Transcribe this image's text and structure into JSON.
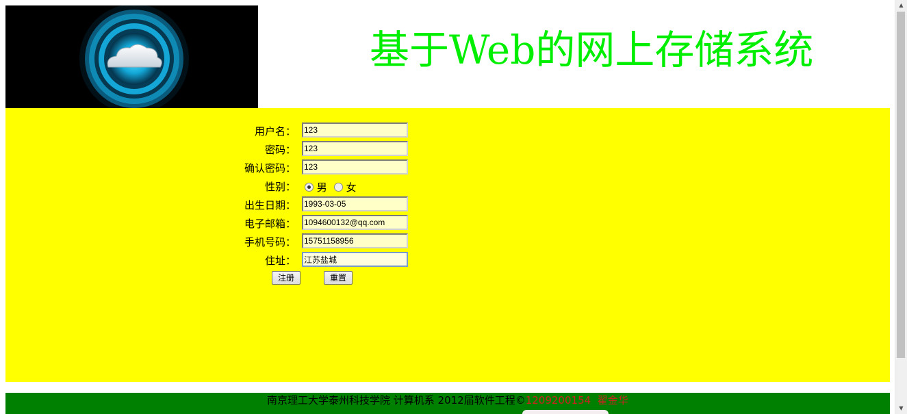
{
  "header": {
    "title": "基于Web的网上存储系统",
    "logo_icon": "cloud-icon"
  },
  "form": {
    "username": {
      "label": "用户名：",
      "value": "123"
    },
    "password": {
      "label": "密码：",
      "value": "123"
    },
    "confirm_password": {
      "label": "确认密码：",
      "value": "123"
    },
    "gender": {
      "label": "性别：",
      "options": [
        {
          "label": "男",
          "checked": true
        },
        {
          "label": "女",
          "checked": false
        }
      ]
    },
    "birthdate": {
      "label": "出生日期：",
      "value": "1993-03-05"
    },
    "email": {
      "label": "电子邮箱：",
      "value": "1094600132@qq.com"
    },
    "phone": {
      "label": "手机号码：",
      "value": "15751158956"
    },
    "address": {
      "label": "住址：",
      "value": "江苏盐城"
    },
    "register_label": "注册",
    "reset_label": "重置"
  },
  "footer": {
    "text_school": "南京理工大学泰州科技学院 计算机系 2012届软件工程©",
    "text_id": "1209200154",
    "text_name": "翟金华"
  },
  "colors": {
    "title": "#00ee00",
    "panel": "#ffff00",
    "footer": "#008000",
    "footer_highlight": "#cc2222"
  }
}
